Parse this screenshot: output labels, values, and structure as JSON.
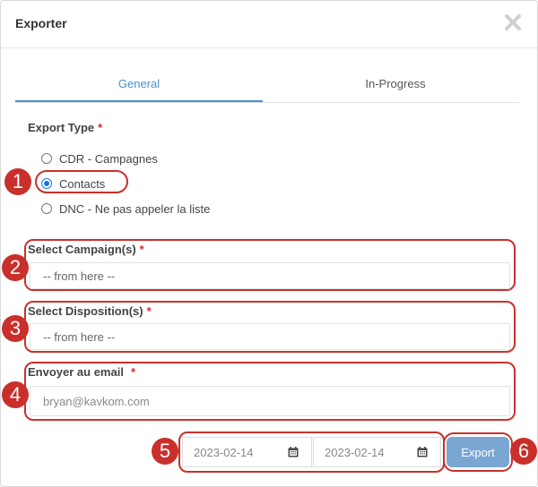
{
  "modal": {
    "title": "Exporter",
    "close_icon": "close-icon"
  },
  "tabs": [
    {
      "label": "General",
      "active": true
    },
    {
      "label": "In-Progress",
      "active": false
    }
  ],
  "export_type": {
    "label": "Export Type",
    "required_mark": "*",
    "options": [
      {
        "label": "CDR - Campagnes",
        "checked": false
      },
      {
        "label": "Contacts",
        "checked": true
      },
      {
        "label": "DNC - Ne pas appeler la liste",
        "checked": false
      }
    ]
  },
  "campaign": {
    "label": "Select Campaign(s)",
    "required_mark": "*",
    "value": "-- from here --"
  },
  "disposition": {
    "label": "Select Disposition(s)",
    "required_mark": "*",
    "value": "-- from here --"
  },
  "email": {
    "label": "Envoyer au email",
    "required_mark": "*",
    "value": "bryan@kavkom.com"
  },
  "date_range": {
    "start": "2023-02-14",
    "end": "2023-02-14",
    "icon": "calendar-icon"
  },
  "export_button": {
    "label": "Export"
  },
  "annotations": [
    "1",
    "2",
    "3",
    "4",
    "5",
    "6"
  ],
  "colors": {
    "accent": "#4a90c8",
    "required": "#e0262c",
    "annotation": "#c9302c",
    "export_button": "#7aa6d4"
  }
}
